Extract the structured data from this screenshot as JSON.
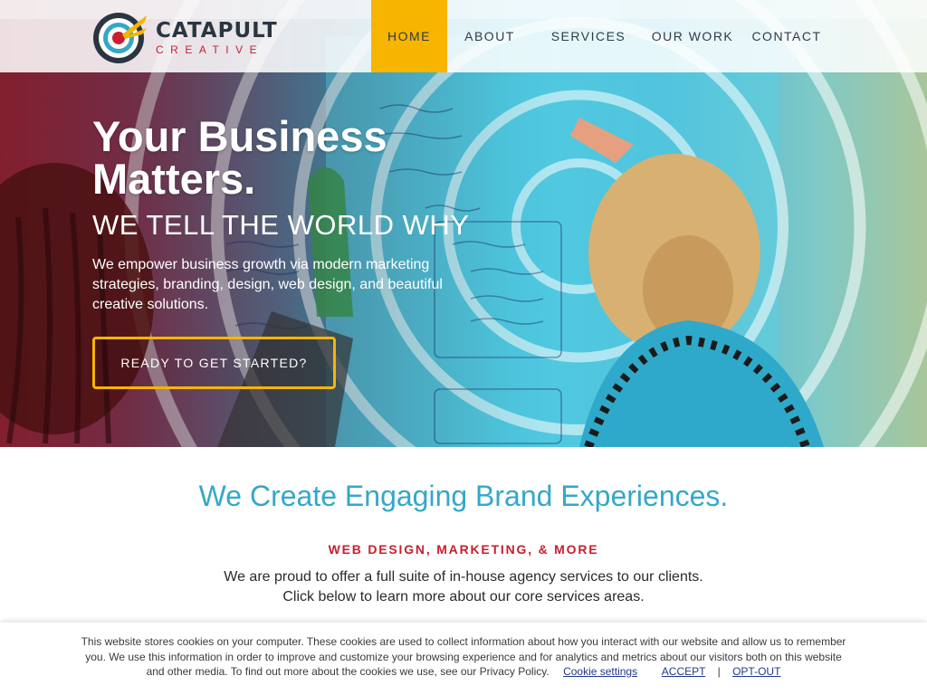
{
  "brand": {
    "name": "CATAPULT",
    "sub": "CREATIVE",
    "colors": {
      "yellow": "#f7b500",
      "red": "#c8202f",
      "blue": "#34a8c9",
      "navy": "#2a3540"
    }
  },
  "nav": {
    "items": [
      {
        "label": "HOME",
        "active": true
      },
      {
        "label": "ABOUT"
      },
      {
        "label": "SERVICES"
      },
      {
        "label": "OUR WORK"
      },
      {
        "label": "CONTACT"
      }
    ]
  },
  "hero": {
    "title": "Your Business Matters.",
    "tagline": "WE TELL THE WORLD WHY",
    "description": "We empower business growth via modern marketing strategies, branding, design, web design, and beautiful creative solutions.",
    "cta": "READY TO GET STARTED?"
  },
  "intro": {
    "title": "We Create Engaging Brand Experiences.",
    "kicker": "WEB DESIGN, MARKETING, & MORE",
    "line1": "We are proud to offer a full suite of in-house agency services to our clients.",
    "line2": "Click below to learn more about our core services areas."
  },
  "cookie": {
    "text": "This website stores cookies on your computer. These cookies are used to collect information about how you interact with our website and allow us to remember you. We use this information in order to improve and customize your browsing experience and for analytics and metrics about our visitors both on this website",
    "last_line": "and other media. To find out more about the cookies we use, see our Privacy Policy.",
    "settings_label": "Cookie settings",
    "accept_label": "ACCEPT",
    "separator": "|",
    "optout_label": "OPT-OUT"
  }
}
